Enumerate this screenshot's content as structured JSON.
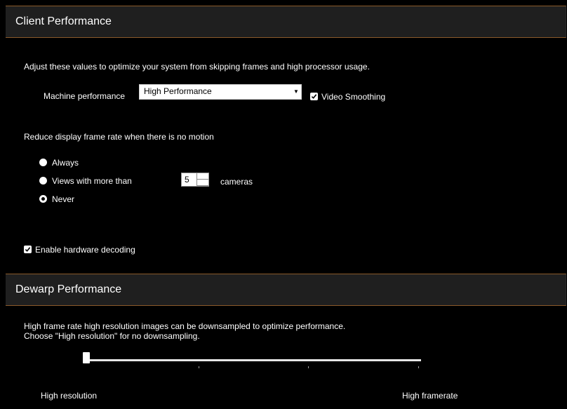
{
  "client_performance": {
    "header": "Client Performance",
    "description": "Adjust these values to optimize your system from skipping frames and high processor usage.",
    "machine_performance_label": "Machine performance",
    "machine_performance_value": "High Performance",
    "video_smoothing_label": "Video Smoothing",
    "video_smoothing_checked": true,
    "reduce_label": "Reduce display frame rate when there is no motion",
    "radio_options": [
      {
        "label": "Always",
        "selected": false
      },
      {
        "label": "Views with more than",
        "selected": false
      },
      {
        "label": "Never",
        "selected": true
      }
    ],
    "cameras_count": "5",
    "cameras_label": "cameras",
    "hardware_decoding_label": "Enable hardware decoding",
    "hardware_decoding_checked": true
  },
  "dewarp_performance": {
    "header": "Dewarp Performance",
    "description_line1": "High frame rate high resolution images can be downsampled to optimize performance.",
    "description_line2": "Choose \"High resolution\" for no downsampling.",
    "slider_min_label": "High resolution",
    "slider_max_label": "High framerate",
    "slider_fraction": 0
  },
  "colors": {
    "background": "#000000",
    "header_bg": "#1f1f1f",
    "header_border": "#8a5a2a",
    "text": "#ffffff"
  }
}
